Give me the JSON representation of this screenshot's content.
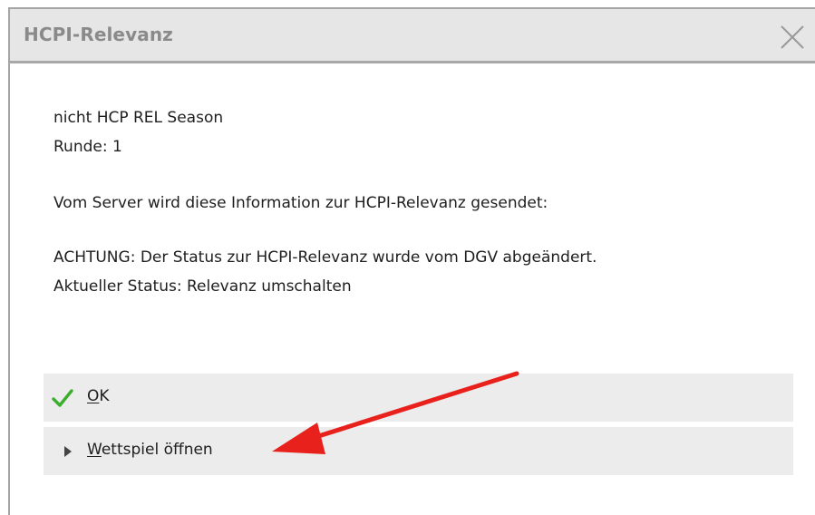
{
  "dialog": {
    "title": "HCPI-Relevanz",
    "close_icon": "close-icon"
  },
  "message": {
    "line1": "nicht HCP REL Season",
    "line2": "Runde: 1",
    "line3": "Vom Server wird diese Information zur HCPI-Relevanz gesendet:",
    "line4": "ACHTUNG: Der Status zur HCPI-Relevanz wurde vom DGV abgeändert.",
    "line5": "Aktueller Status: Relevanz umschalten"
  },
  "actions": {
    "ok": {
      "mnemonic": "O",
      "rest": "K",
      "icon": "checkmark-icon",
      "icon_color": "#3dad2d"
    },
    "open_game": {
      "mnemonic": "W",
      "rest": "ettspiel öffnen",
      "icon": "triangle-right-icon"
    }
  },
  "annotation": {
    "icon": "red-arrow-icon",
    "color": "#e8211d"
  }
}
